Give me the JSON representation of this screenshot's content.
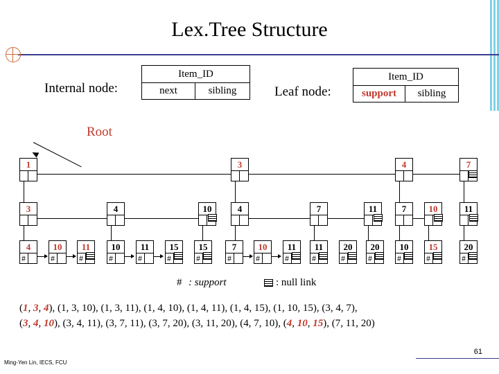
{
  "title": "Lex.Tree Structure",
  "legend": {
    "internal_label": "Internal node:",
    "internal_item_id": "Item_ID",
    "internal_next": "next",
    "internal_sibling": "sibling",
    "leaf_label": "Leaf node:",
    "leaf_item_id": "Item_ID",
    "leaf_support": "support",
    "leaf_sibling": "sibling"
  },
  "root_label": "Root",
  "keys": {
    "support_symbol": "#",
    "support_text": ": support",
    "nulllink_text": ": null link"
  },
  "tree": {
    "level1": [
      "1",
      "3",
      "4",
      "7"
    ],
    "level2": [
      "3",
      "4",
      "10",
      "4",
      "7",
      "11",
      "7",
      "10",
      "11"
    ],
    "level3": [
      "4",
      "10",
      "11",
      "10",
      "11",
      "15",
      "15",
      "7",
      "10",
      "11",
      "11",
      "20",
      "20",
      "10",
      "15",
      "20"
    ]
  },
  "sequences": {
    "line1": "(1, 3, 4), (1, 3, 10), (1, 3, 11), (1, 4, 10), (1, 4, 11), (1, 4, 15), (1, 10, 15), (3, 4, 7),",
    "line2": "(3, 4, 10), (3, 4, 11), (3, 7, 11), (3, 7, 20), (3, 11, 20), (4, 7, 10), (4, 10, 15), (7, 11, 20)"
  },
  "footer": "Ming-Yen Lin, IECS, FCU",
  "page_number": "61"
}
